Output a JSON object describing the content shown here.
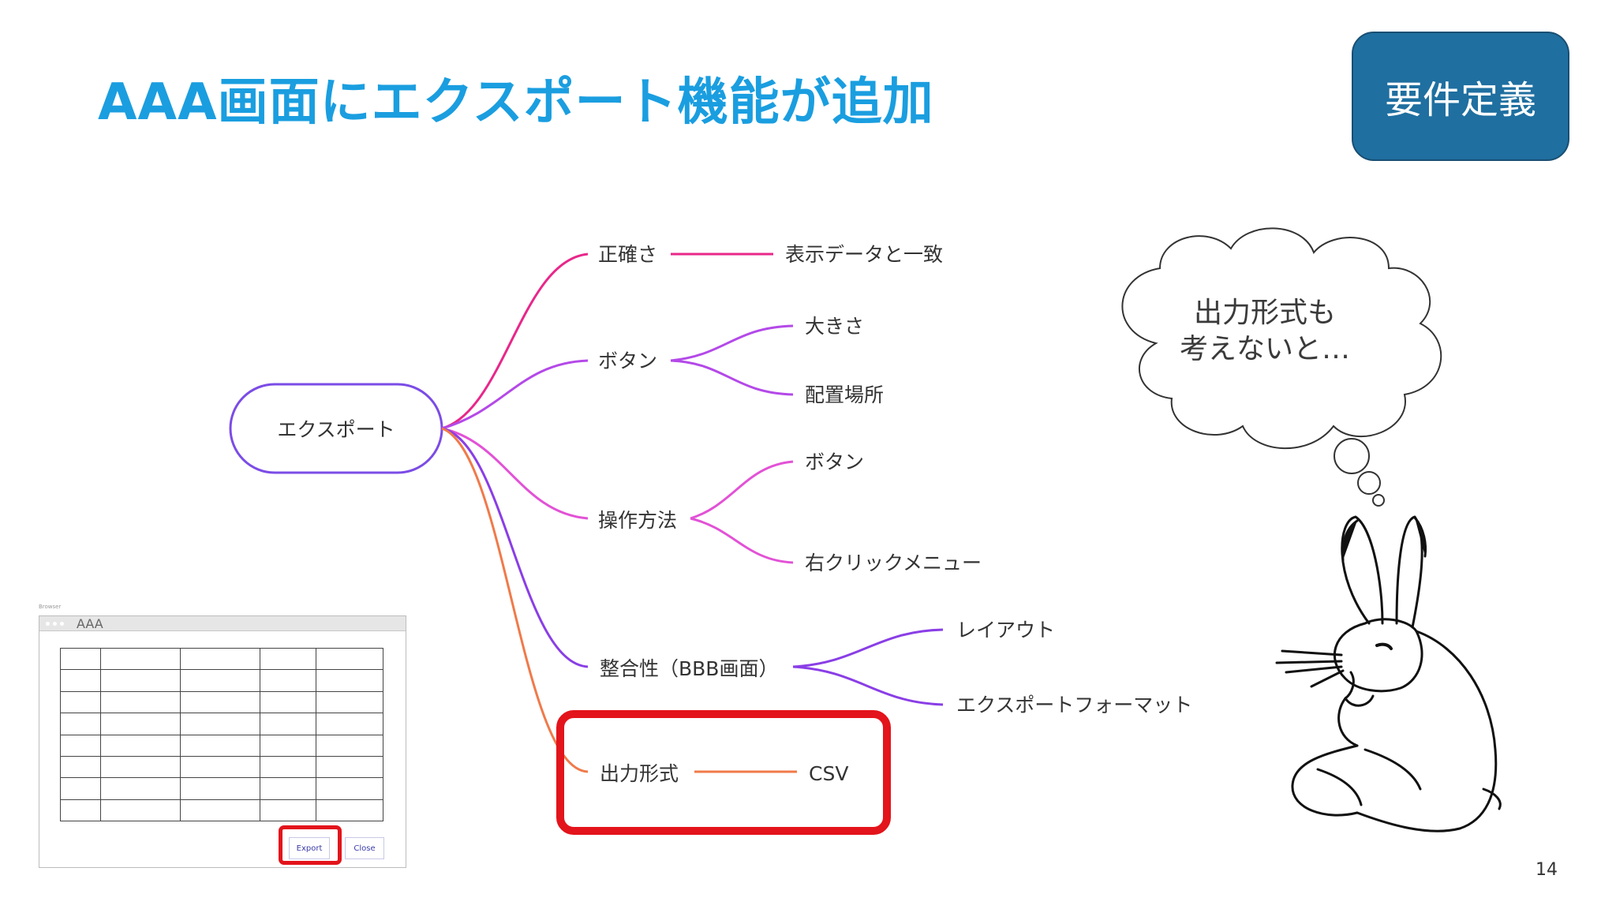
{
  "slide": {
    "title": "AAA画面にエクスポート機能が追加",
    "badge": "要件定義",
    "page_number": "14"
  },
  "mindmap": {
    "root": "エクスポート",
    "branches": [
      {
        "label": "正確さ",
        "color": "#e8278a",
        "children": [
          "表示データと一致"
        ]
      },
      {
        "label": "ボタン",
        "color": "#b449e8",
        "children": [
          "大きさ",
          "配置場所"
        ]
      },
      {
        "label": "操作方法",
        "color": "#e252d6",
        "children": [
          "ボタン",
          "右クリックメニュー"
        ]
      },
      {
        "label": "整合性（BBB画面）",
        "color": "#8a3ee6",
        "children": [
          "レイアウト",
          "エクスポートフォーマット"
        ]
      },
      {
        "label": "出力形式",
        "color": "#f07a4a",
        "children": [
          "CSV"
        ]
      }
    ],
    "root_border_color": "#7b4ce6"
  },
  "thought_bubble": {
    "line1": "出力形式も",
    "line2": "考えないと…"
  },
  "mock_browser": {
    "caption": "Browser",
    "title": "AAA",
    "export_label": "Export",
    "close_label": "Close"
  },
  "highlight_color": "#e3141b"
}
